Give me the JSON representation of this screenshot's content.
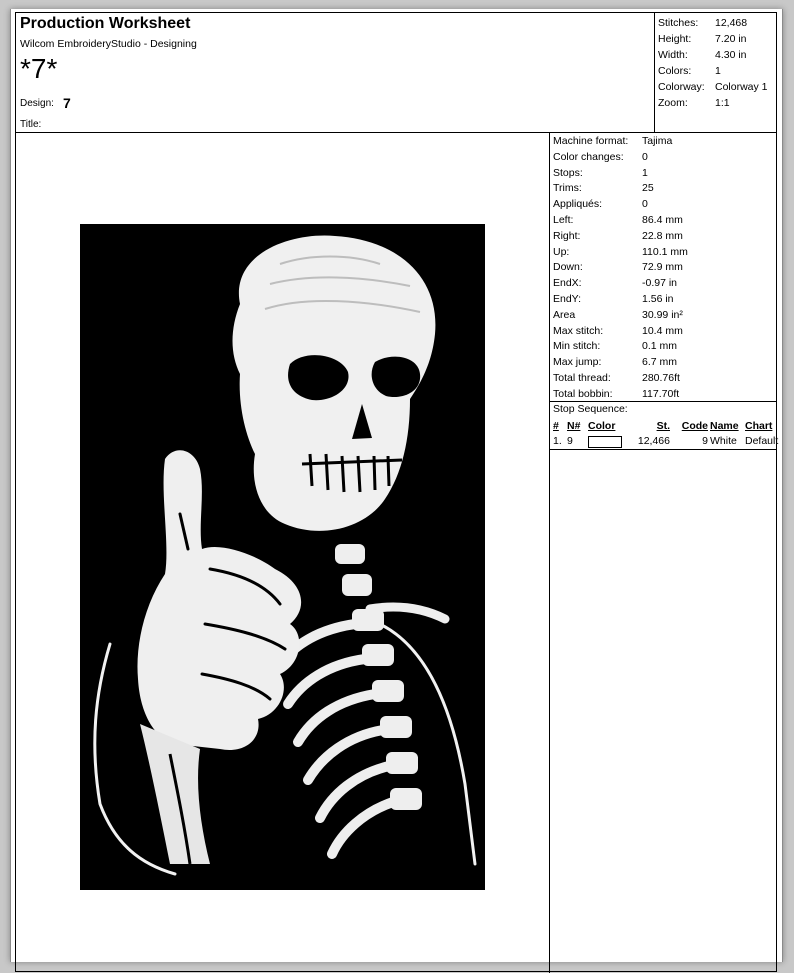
{
  "header": {
    "title": "Production Worksheet",
    "subtitle": "Wilcom EmbroideryStudio - Designing",
    "design_name": "*7*",
    "design_label": "Design:",
    "design_value": "7",
    "title_label": "Title:"
  },
  "summary": [
    {
      "label": "Stitches:",
      "value": "12,468"
    },
    {
      "label": "Height:",
      "value": "7.20 in"
    },
    {
      "label": "Width:",
      "value": "4.30 in"
    },
    {
      "label": "Colors:",
      "value": "1"
    },
    {
      "label": "Colorway:",
      "value": "Colorway 1"
    },
    {
      "label": "Zoom:",
      "value": "1:1"
    }
  ],
  "properties": [
    {
      "label": "Machine format:",
      "value": "Tajima"
    },
    {
      "label": "Color changes:",
      "value": "0"
    },
    {
      "label": "Stops:",
      "value": "1"
    },
    {
      "label": "Trims:",
      "value": "25"
    },
    {
      "label": "Appliqués:",
      "value": "0"
    },
    {
      "label": "Left:",
      "value": "86.4 mm"
    },
    {
      "label": "Right:",
      "value": "22.8 mm"
    },
    {
      "label": "Up:",
      "value": "110.1 mm"
    },
    {
      "label": "Down:",
      "value": "72.9 mm"
    },
    {
      "label": "EndX:",
      "value": "-0.97 in"
    },
    {
      "label": "EndY:",
      "value": "1.56 in"
    },
    {
      "label": "Area",
      "value": " 30.99 in²"
    },
    {
      "label": "Max stitch:",
      "value": "10.4 mm"
    },
    {
      "label": "Min stitch:",
      "value": "0.1 mm"
    },
    {
      "label": "Max jump:",
      "value": "6.7 mm"
    },
    {
      "label": "Total thread:",
      "value": "280.76ft"
    },
    {
      "label": "Total bobbin:",
      "value": "117.70ft"
    }
  ],
  "stop_sequence": {
    "title": "Stop Sequence:",
    "headers": [
      "#",
      "N#",
      "Color",
      "St.",
      "Code",
      "Name",
      "Chart"
    ],
    "rows": [
      {
        "num": "1.",
        "n": "9",
        "stitches": "12,466",
        "code": "9",
        "name": "White",
        "chart": "Default"
      }
    ]
  },
  "colors": {
    "thread": "#ffffff",
    "background": "#000000"
  },
  "artwork": {
    "icon": "skeleton-thumbs-up-embroidery"
  }
}
